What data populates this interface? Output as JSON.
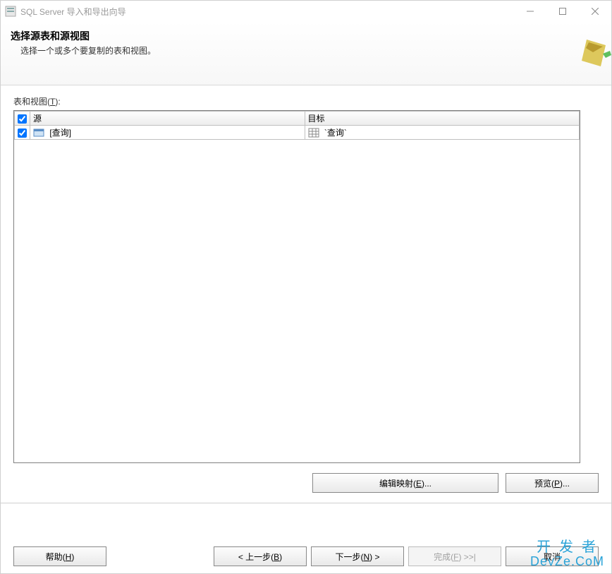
{
  "window": {
    "title": "SQL Server 导入和导出向导"
  },
  "header": {
    "heading": "选择源表和源视图",
    "description": "选择一个或多个要复制的表和视图。"
  },
  "section": {
    "label_prefix": "表和视图(",
    "label_access": "T",
    "label_suffix": "):"
  },
  "grid": {
    "columns": {
      "source": "源",
      "target": "目标"
    },
    "rows": [
      {
        "checked": true,
        "source_label": "[查询]",
        "target_label": "`查询`"
      }
    ]
  },
  "actions": {
    "edit_prefix": "编辑映射(",
    "edit_access": "E",
    "edit_suffix": ")...",
    "preview_prefix": "预览(",
    "preview_access": "P",
    "preview_suffix": ")..."
  },
  "footer": {
    "help_prefix": "帮助(",
    "help_access": "H",
    "help_suffix": ")",
    "back_prefix": "< 上一步(",
    "back_access": "B",
    "back_suffix": ")",
    "next_prefix": "下一步(",
    "next_access": "N",
    "next_suffix": ") >",
    "finish_prefix": "完成(",
    "finish_access": "F",
    "finish_suffix": ") >>|",
    "cancel": "取消"
  },
  "watermark": {
    "line1": "开发者",
    "line2": "DevZe.CoM"
  }
}
